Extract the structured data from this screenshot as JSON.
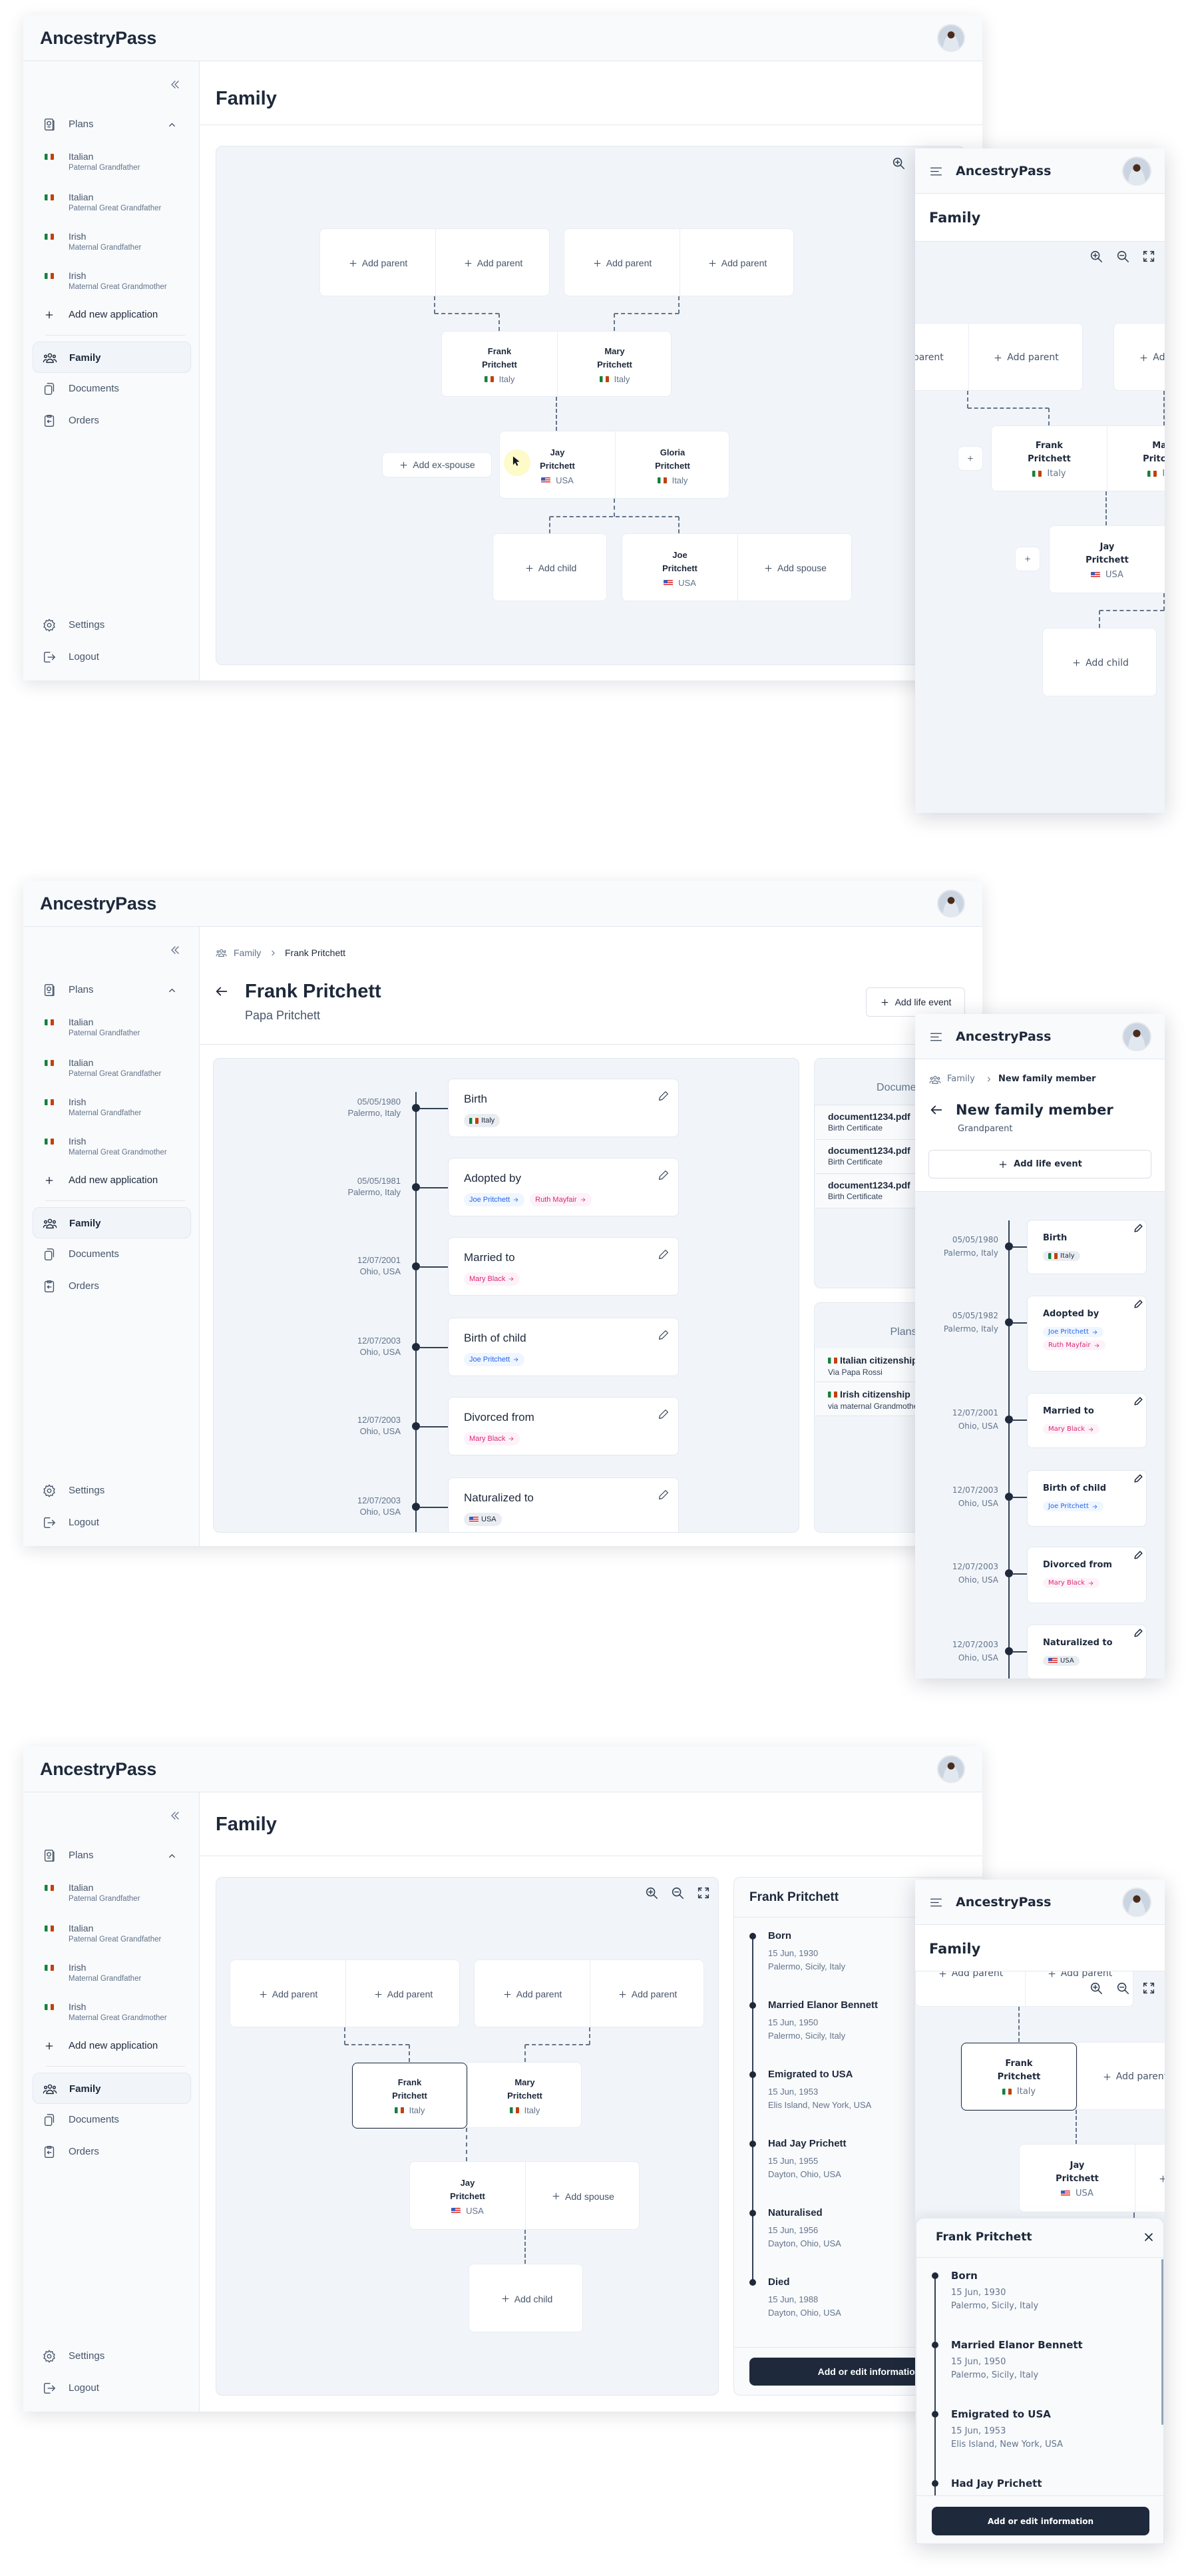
{
  "app": {
    "name": "AncestryPass"
  },
  "colors": {
    "primary_dark": "#1e293b",
    "canvas_bg": "#f1f5f9",
    "chip_blue": "#2563eb",
    "chip_pink": "#db2777",
    "cursor_highlight": "#fef9c3"
  },
  "sidebar": {
    "plans_label": "Plans",
    "plans": [
      {
        "title": "Italian",
        "subtitle": "Paternal Grandfather",
        "flag": "it"
      },
      {
        "title": "Italian",
        "subtitle": "Paternal Great Grandfather",
        "flag": "it"
      },
      {
        "title": "Irish",
        "subtitle": "Maternal Grandfather",
        "flag": "it"
      },
      {
        "title": "Irish",
        "subtitle": "Maternal Great Grandmother",
        "flag": "it"
      }
    ],
    "add_application": "Add new application",
    "family": "Family",
    "documents": "Documents",
    "orders": "Orders",
    "settings": "Settings",
    "logout": "Logout"
  },
  "tree": {
    "add_parent": "Add parent",
    "add_child": "Add child",
    "add_spouse": "Add spouse",
    "add_ex_spouse": "Add ex-spouse",
    "people": {
      "frank": {
        "first": "Frank",
        "last": "Pritchett",
        "country": "Italy",
        "flag": "it"
      },
      "mary": {
        "first": "Mary",
        "last": "Pritchett",
        "country": "Italy",
        "flag": "it"
      },
      "jay": {
        "first": "Jay",
        "last": "Pritchett",
        "country": "USA",
        "flag": "us"
      },
      "gloria": {
        "first": "Gloria",
        "last": "Pritchett",
        "country": "Italy",
        "flag": "it"
      },
      "joe": {
        "first": "Joe",
        "last": "Pritchett",
        "country": "USA",
        "flag": "us"
      }
    }
  },
  "family_page": {
    "title": "Family"
  },
  "person_page": {
    "breadcrumb": {
      "root": "Family",
      "current": "Frank Pritchett"
    },
    "title": "Frank Pritchett",
    "subtitle": "Papa Pritchett",
    "add_life_event": "Add life event",
    "events": [
      {
        "date": "05/05/1980",
        "place": "Palermo, Italy",
        "title": "Birth",
        "tags": [
          {
            "label": "Italy",
            "type": "country",
            "flag": "it"
          }
        ]
      },
      {
        "date": "05/05/1981",
        "place": "Palermo, Italy",
        "title": "Adopted  by",
        "tags": [
          {
            "label": "Joe Pritchett",
            "type": "blue"
          },
          {
            "label": "Ruth Mayfair",
            "type": "pink"
          }
        ]
      },
      {
        "date": "12/07/2001",
        "place": "Ohio, USA",
        "title": "Married to",
        "tags": [
          {
            "label": "Mary Black",
            "type": "pink"
          }
        ]
      },
      {
        "date": "12/07/2003",
        "place": "Ohio, USA",
        "title": "Birth of child",
        "tags": [
          {
            "label": "Joe Pritchett",
            "type": "blue"
          }
        ]
      },
      {
        "date": "12/07/2003",
        "place": "Ohio, USA",
        "title": "Divorced from",
        "tags": [
          {
            "label": "Mary Black",
            "type": "pink"
          }
        ]
      },
      {
        "date": "12/07/2003",
        "place": "Ohio, USA",
        "title": "Naturalized to",
        "tags": [
          {
            "label": "USA",
            "type": "country",
            "flag": "us"
          }
        ]
      }
    ],
    "documents": {
      "title": "Documents",
      "items": [
        {
          "name": "document1234.pdf",
          "type": "Birth Certificate"
        },
        {
          "name": "document1234.pdf",
          "type": "Birth Certificate"
        },
        {
          "name": "document1234.pdf",
          "type": "Birth Certificate"
        }
      ]
    },
    "plans": {
      "title": "Plans",
      "items": [
        {
          "name": "Italian citizenship",
          "via": "Via Papa Rossi",
          "flag": "it"
        },
        {
          "name": "Irish citizenship",
          "via": "via maternal Grandmother",
          "flag": "it"
        }
      ]
    }
  },
  "new_member_page": {
    "breadcrumb": {
      "root": "Family",
      "current": "New family member"
    },
    "title": "New family member",
    "subtitle": "Grandparent",
    "add_life_event": "Add life event",
    "events": [
      {
        "date": "05/05/1980",
        "place": "Palermo, Italy",
        "title": "Birth",
        "tags": [
          {
            "label": "Italy",
            "type": "country",
            "flag": "it"
          }
        ]
      },
      {
        "date": "05/05/1982",
        "place": "Palermo, Italy",
        "title": "Adopted by",
        "tags": [
          {
            "label": "Joe Pritchett",
            "type": "blue"
          },
          {
            "label": "Ruth Mayfair",
            "type": "pink"
          }
        ]
      },
      {
        "date": "12/07/2001",
        "place": "Ohio, USA",
        "title": "Married to",
        "tags": [
          {
            "label": "Mary Black",
            "type": "pink"
          }
        ]
      },
      {
        "date": "12/07/2003",
        "place": "Ohio, USA",
        "title": "Birth of child",
        "tags": [
          {
            "label": "Joe Pritchett",
            "type": "blue"
          }
        ]
      },
      {
        "date": "12/07/2003",
        "place": "Ohio, USA",
        "title": "Divorced from",
        "tags": [
          {
            "label": "Mary Black",
            "type": "pink"
          }
        ]
      },
      {
        "date": "12/07/2003",
        "place": "Ohio, USA",
        "title": "Naturalized to",
        "tags": [
          {
            "label": "USA",
            "type": "country",
            "flag": "us"
          }
        ]
      }
    ]
  },
  "details_panel": {
    "title": "Frank Pritchett",
    "events": [
      {
        "title": "Born",
        "date": "15 Jun, 1930",
        "place": "Palermo, Sicily, Italy"
      },
      {
        "title": "Married Elanor Bennett",
        "date": "15 Jun, 1950",
        "place": "Palermo, Sicily, Italy"
      },
      {
        "title": "Emigrated to USA",
        "date": "15 Jun, 1953",
        "place": "Elis Island, New York, USA"
      },
      {
        "title": "Had Jay Prichett",
        "date": "15 Jun, 1955",
        "place": "Dayton, Ohio, USA"
      },
      {
        "title": "Naturalised",
        "date": "15 Jun, 1956",
        "place": "Dayton, Ohio, USA"
      },
      {
        "title": "Died",
        "date": "15 Jun, 1988",
        "place": "Dayton, Ohio, USA"
      }
    ],
    "button": "Add or edit information"
  },
  "icons": [
    "collapse-sidebar-icon",
    "passport-icon",
    "chevron-up-icon",
    "plus-icon",
    "family-icon",
    "documents-icon",
    "orders-icon",
    "settings-icon",
    "logout-icon",
    "zoom-in-icon",
    "zoom-out-icon",
    "fullscreen-icon",
    "pencil-icon",
    "arrow-left-icon",
    "arrow-right-icon",
    "menu-icon",
    "close-icon",
    "chevron-right-icon",
    "cursor-icon"
  ]
}
